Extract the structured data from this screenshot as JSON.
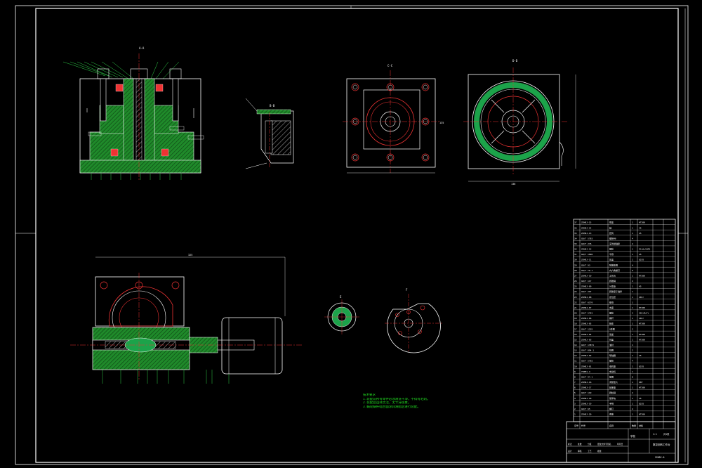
{
  "drawing": {
    "colors": {
      "background": "#000000",
      "outline": "#ffffff",
      "section_fill": "#22c22c",
      "centerline": "#ff2a2a",
      "gear_ring": "#1ca34a",
      "dimension": "#ffffff"
    },
    "view_labels": {
      "section_top": "A-A",
      "detail_small": "B-B",
      "plan_view": "C-C",
      "side_view": "D-D",
      "small_disk": "E",
      "cam_plate": "F"
    },
    "dimensions": {
      "front_width": "128",
      "length_bottom": "325",
      "plan_height": "135",
      "side_width": "136"
    },
    "notes": {
      "title": "技术要求",
      "lines": [
        "1.装配前所有零件必须清洗干净，不得有毛刺。",
        "2.装配后运转灵活，无卡滞现象。",
        "3.蜗轮蜗杆啮合面涂润滑脂后进行装配。"
      ]
    },
    "bom": {
      "rows": [
        {
          "no": "37",
          "code": "ZXHDJ-15",
          "name": "端盖",
          "qty": "1",
          "material": "HT200"
        },
        {
          "no": "36",
          "code": "ZXHDJ-14",
          "name": "轴",
          "qty": "1",
          "material": "45"
        },
        {
          "no": "35",
          "code": "ZXHDJ-13",
          "name": "套筒",
          "qty": "1",
          "material": "45"
        },
        {
          "no": "34",
          "code": "GB/T 5783",
          "name": "螺栓M8",
          "qty": "4",
          "material": ""
        },
        {
          "no": "33",
          "code": "GB/T 276",
          "name": "深沟球轴承",
          "qty": "2",
          "material": ""
        },
        {
          "no": "32",
          "code": "ZXHDJ-12",
          "name": "蜗轮",
          "qty": "1",
          "material": "ZCuSn10P1"
        },
        {
          "no": "31",
          "code": "GB/T 1096",
          "name": "平键",
          "qty": "1",
          "material": "45"
        },
        {
          "no": "30",
          "code": "ZXHDJ-11",
          "name": "压盖",
          "qty": "1",
          "material": "Q235"
        },
        {
          "no": "29",
          "code": "GB/T 93",
          "name": "弹簧垫圈",
          "qty": "4",
          "material": ""
        },
        {
          "no": "28",
          "code": "GB/T 70.1",
          "name": "内六角螺钉",
          "qty": "6",
          "material": ""
        },
        {
          "no": "27",
          "code": "ZXHDJ-10",
          "name": "工作台",
          "qty": "1",
          "material": "HT200"
        },
        {
          "no": "26",
          "code": "GB/T 117",
          "name": "圆锥销",
          "qty": "2",
          "material": ""
        },
        {
          "no": "25",
          "code": "ZXHDJ-09",
          "name": "分度盘",
          "qty": "1",
          "material": "45"
        },
        {
          "no": "24",
          "code": "GB/T 297",
          "name": "圆锥滚子轴承",
          "qty": "1",
          "material": ""
        },
        {
          "no": "23",
          "code": "ZXHDJ-08",
          "name": "定位套",
          "qty": "1",
          "material": "40Cr"
        },
        {
          "no": "22",
          "code": "GB/T 6170",
          "name": "螺母",
          "qty": "1",
          "material": ""
        },
        {
          "no": "21",
          "code": "ZXHDJ-07",
          "name": "支座",
          "qty": "1",
          "material": "HT200"
        },
        {
          "no": "20",
          "code": "GB/T 5781",
          "name": "螺栓",
          "qty": "4",
          "material": "20CrMnTi"
        },
        {
          "no": "19",
          "code": "ZXHDJ-06",
          "name": "蜗杆",
          "qty": "1",
          "material": "40Cr"
        },
        {
          "no": "18",
          "code": "ZXHDJ-05",
          "name": "箱体",
          "qty": "1",
          "material": "HT200"
        },
        {
          "no": "17",
          "code": "GB/T 1235",
          "name": "O形圈",
          "qty": "2",
          "material": ""
        },
        {
          "no": "16",
          "code": "ZXHDJ-04",
          "name": "透盖",
          "qty": "1",
          "material": "HT200"
        },
        {
          "no": "15",
          "code": "ZXHDJ-03",
          "name": "闷盖",
          "qty": "1",
          "material": "HT200"
        },
        {
          "no": "14",
          "code": "GB/T 13871",
          "name": "油封",
          "qty": "1",
          "material": ""
        },
        {
          "no": "13",
          "code": "GB/T 894.1",
          "name": "挡圈",
          "qty": "2",
          "material": ""
        },
        {
          "no": "12",
          "code": "ZXHDJ-02",
          "name": "联轴器",
          "qty": "1",
          "material": "45"
        },
        {
          "no": "11",
          "code": "GB/T 5782",
          "name": "螺栓",
          "qty": "4",
          "material": ""
        },
        {
          "no": "10",
          "code": "ZXHDJ-01",
          "name": "电机座",
          "qty": "1",
          "material": "Q235"
        },
        {
          "no": "9",
          "code": "Y80M1-4",
          "name": "电动机",
          "qty": "1",
          "material": ""
        },
        {
          "no": "8",
          "code": "GB/T 97.1",
          "name": "垫圈",
          "qty": "8",
          "material": ""
        },
        {
          "no": "7",
          "code": "ZXHDJ-16",
          "name": "调整垫片",
          "qty": "1",
          "material": "08F"
        },
        {
          "no": "6",
          "code": "ZXHDJ-17",
          "name": "轴承座",
          "qty": "1",
          "material": "HT200"
        },
        {
          "no": "5",
          "code": "GB/T 119",
          "name": "圆柱销",
          "qty": "2",
          "material": ""
        },
        {
          "no": "4",
          "code": "ZXHDJ-18",
          "name": "锁紧块",
          "qty": "1",
          "material": "45"
        },
        {
          "no": "3",
          "code": "ZXHDJ-19",
          "name": "手柄",
          "qty": "1",
          "material": "Q235"
        },
        {
          "no": "2",
          "code": "GB/T 65",
          "name": "螺钉",
          "qty": "4",
          "material": ""
        },
        {
          "no": "1",
          "code": "ZXHDJ-20",
          "name": "底座",
          "qty": "1",
          "material": "HT200"
        }
      ],
      "header": {
        "no": "序号",
        "code": "代号",
        "name": "名称",
        "qty": "数量",
        "material": "材料"
      }
    },
    "title_block": {
      "drawing_title": "数控回转工作台",
      "drawing_no": "ZXHDJ-0",
      "scale": "1:1",
      "sheet": "共1张",
      "unit": "学校",
      "labels": [
        "标记",
        "处数",
        "分区",
        "更改文件号",
        "签名",
        "年月日",
        "设计",
        "审核",
        "工艺",
        "批准"
      ]
    }
  }
}
